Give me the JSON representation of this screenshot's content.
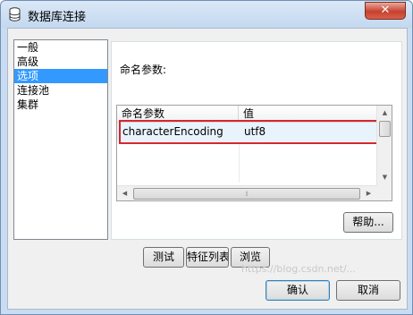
{
  "window": {
    "title": "数据库连接",
    "close_label": "✕"
  },
  "nav": {
    "items": [
      "一般",
      "高级",
      "选项",
      "连接池",
      "集群"
    ],
    "selected_index": 2
  },
  "options": {
    "heading": "命名参数:",
    "table": {
      "columns": [
        "命名参数",
        "值"
      ],
      "rows": [
        {
          "name": "characterEncoding",
          "value": "utf8"
        }
      ]
    },
    "help_button": "帮助..."
  },
  "actions": {
    "test": "测试",
    "feature_list": "特征列表",
    "browse": "浏览"
  },
  "footer": {
    "ok": "确认",
    "cancel": "取消",
    "watermark": "https://blog.csdn.net/..."
  },
  "colors": {
    "selection": "#3399ff",
    "highlight_border": "#d7262e"
  }
}
